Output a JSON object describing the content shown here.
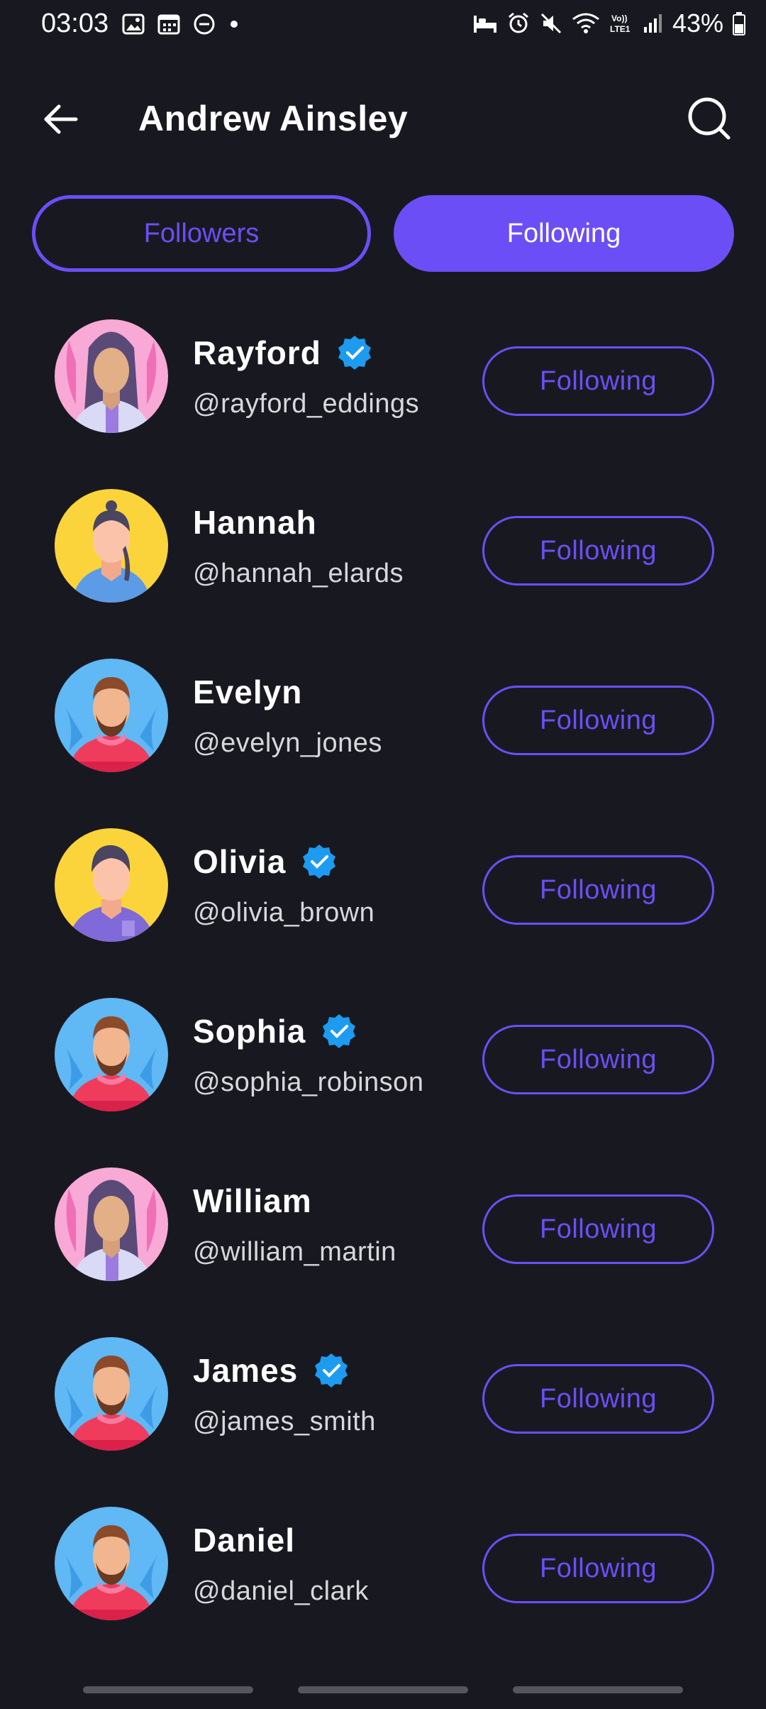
{
  "status_bar": {
    "time": "03:03",
    "battery": "43%",
    "icons": [
      "image-icon",
      "calendar-icon",
      "dnd-icon",
      "dot-icon",
      "sleep-icon",
      "alarm-icon",
      "mute-icon",
      "wifi-icon",
      "volte-icon",
      "signal-icon",
      "battery-icon"
    ]
  },
  "header": {
    "title": "Andrew Ainsley",
    "back_icon": "arrow-left-icon",
    "search_icon": "search-icon"
  },
  "tabs": {
    "followers": "Followers",
    "following": "Following",
    "active": "following"
  },
  "colors": {
    "accent": "#6C4EF7",
    "background": "#181920",
    "verified": "#1D9BF0"
  },
  "users": [
    {
      "name": "Rayford",
      "handle": "@rayford_eddings",
      "verified": true,
      "button": "Following",
      "avatar": "woman-pink"
    },
    {
      "name": "Hannah",
      "handle": "@hannah_elards",
      "verified": false,
      "button": "Following",
      "avatar": "woman-yellow-blue"
    },
    {
      "name": "Evelyn",
      "handle": "@evelyn_jones",
      "verified": false,
      "button": "Following",
      "avatar": "man-beard-blue"
    },
    {
      "name": "Olivia",
      "handle": "@olivia_brown",
      "verified": true,
      "button": "Following",
      "avatar": "man-yellow-purple"
    },
    {
      "name": "Sophia",
      "handle": "@sophia_robinson",
      "verified": true,
      "button": "Following",
      "avatar": "man-beard-blue"
    },
    {
      "name": "William",
      "handle": "@william_martin",
      "verified": false,
      "button": "Following",
      "avatar": "woman-pink"
    },
    {
      "name": "James",
      "handle": "@james_smith",
      "verified": true,
      "button": "Following",
      "avatar": "man-beard-blue"
    },
    {
      "name": "Daniel",
      "handle": "@daniel_clark",
      "verified": false,
      "button": "Following",
      "avatar": "man-beard-blue"
    }
  ]
}
